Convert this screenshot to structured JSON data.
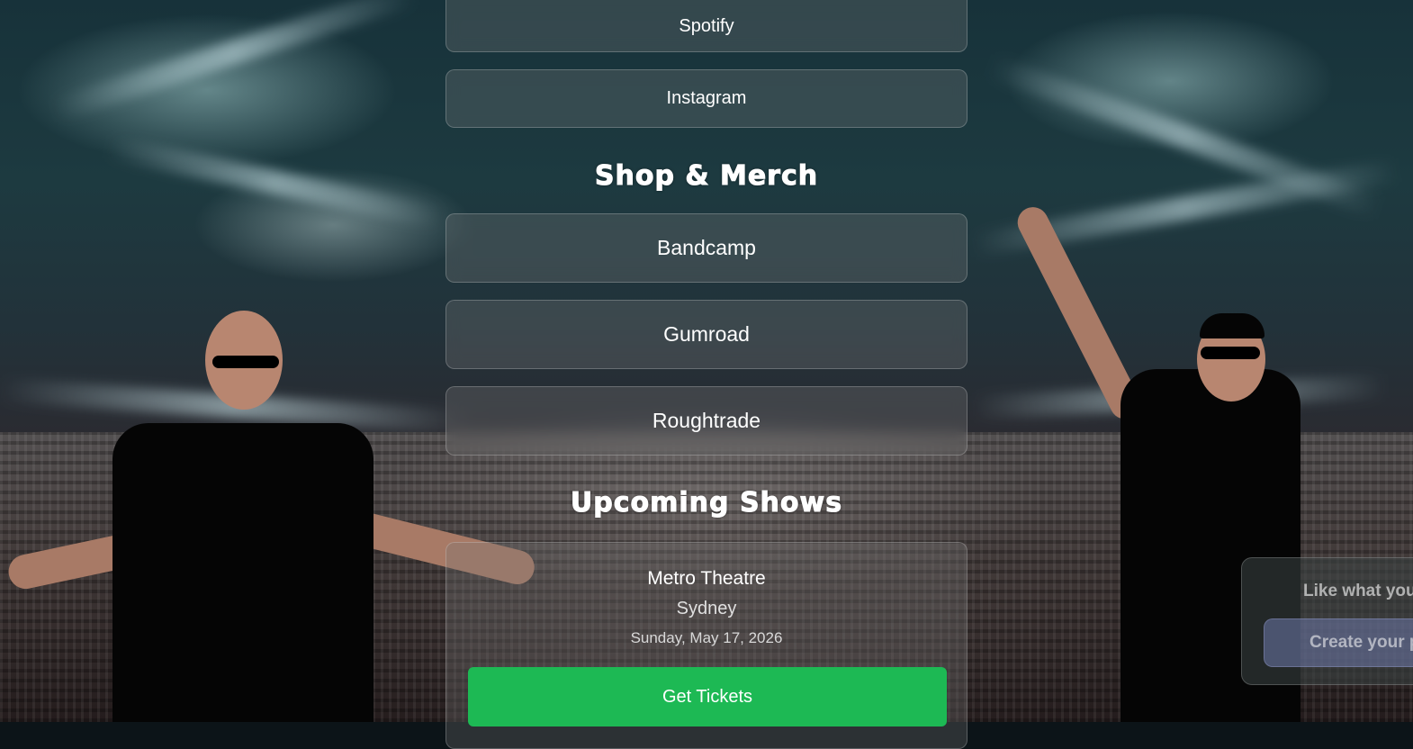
{
  "links": {
    "spotify": "Spotify",
    "instagram": "Instagram"
  },
  "shop": {
    "title": "Shop & Merch",
    "items": [
      "Bandcamp",
      "Gumroad",
      "Roughtrade"
    ]
  },
  "shows": {
    "title": "Upcoming Shows",
    "items": [
      {
        "venue": "Metro Theatre",
        "city": "Sydney",
        "date": "Sunday, May 17, 2026",
        "button": "Get Tickets"
      }
    ]
  },
  "promo": {
    "text": "Like what you see?",
    "button": "Create your page"
  },
  "colors": {
    "tickets_button": "#1db954",
    "card_border": "rgba(255,255,255,0.22)"
  }
}
